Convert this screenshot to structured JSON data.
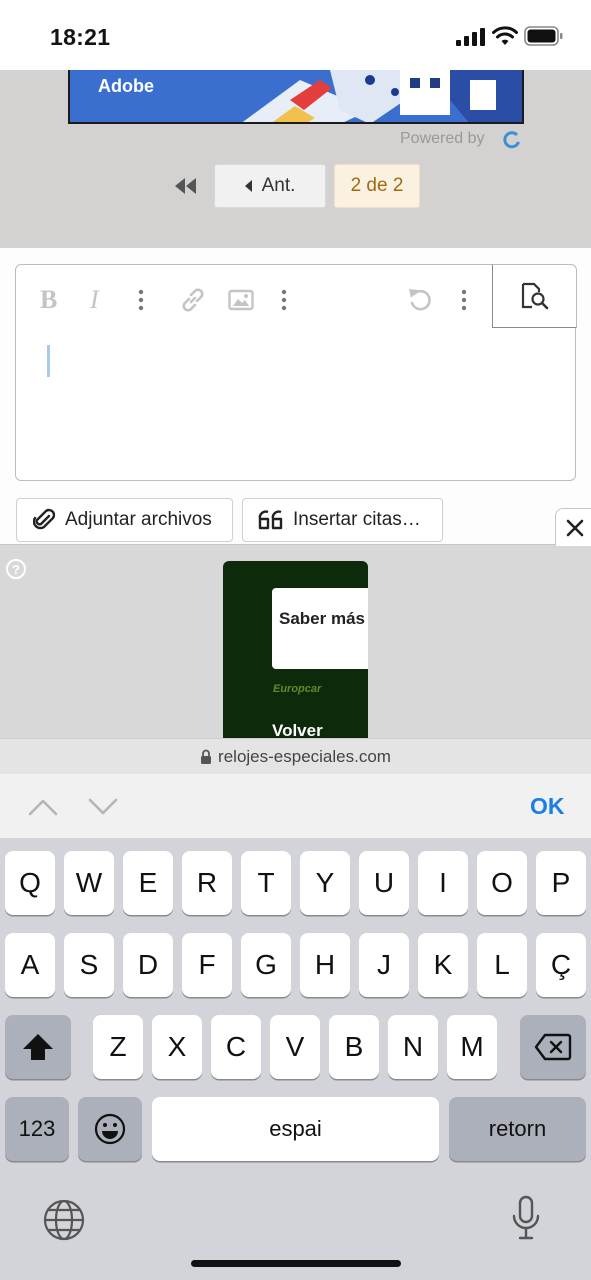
{
  "status_bar": {
    "time": "18:21"
  },
  "ad_banner": {
    "brand": "Adobe",
    "powered_by": "Powered by"
  },
  "pagination": {
    "prev_label": "Ant.",
    "current": "2 de 2"
  },
  "editor": {
    "toolbar": {
      "bold_label": "B",
      "italic_label": "I",
      "icons": [
        "link-icon",
        "image-icon",
        "undo-icon",
        "more-options-icon",
        "preview-icon"
      ]
    }
  },
  "actions": {
    "attach_label": "Adjuntar archivos",
    "quote_label": "Insertar citas…"
  },
  "sticky_ad": {
    "cta": "Saber más",
    "brand": "Europcar",
    "back_label": "Volver"
  },
  "url_bar": {
    "domain": "relojes-especiales.com"
  },
  "keyboard_accessory": {
    "ok_label": "OK"
  },
  "keyboard": {
    "row1": [
      "Q",
      "W",
      "E",
      "R",
      "T",
      "Y",
      "U",
      "I",
      "O",
      "P"
    ],
    "row2": [
      "A",
      "S",
      "D",
      "F",
      "G",
      "H",
      "J",
      "K",
      "L",
      "Ç"
    ],
    "row3": [
      "Z",
      "X",
      "C",
      "V",
      "B",
      "N",
      "M"
    ],
    "numbers_label": "123",
    "space_label": "espai",
    "return_label": "retorn"
  },
  "colors": {
    "accent": "#1a7ee6",
    "pager_current_text": "#a06a10",
    "ad_background": "#0d2a0a"
  }
}
